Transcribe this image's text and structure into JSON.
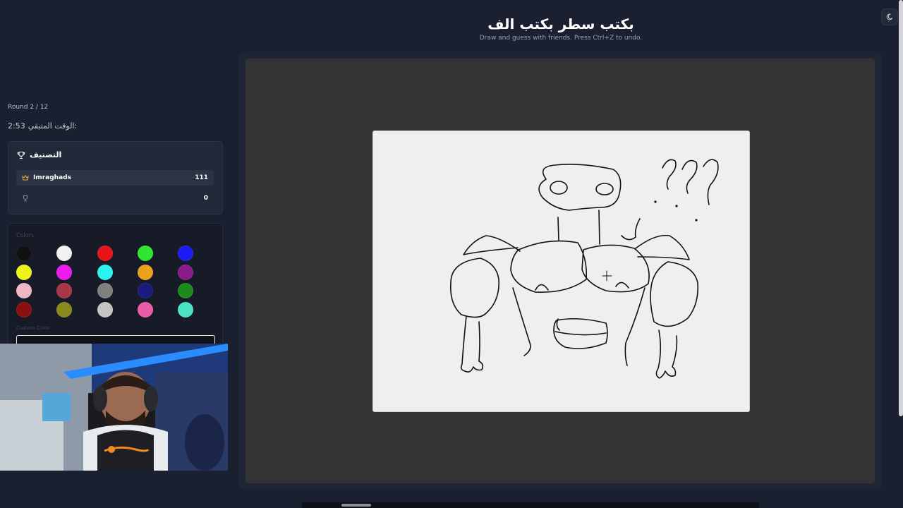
{
  "header": {
    "title": "بكتب سطر بكتب الف",
    "subtitle": "Draw and guess with friends. Press Ctrl+Z to undo."
  },
  "theme_toggle_icon": "moon-icon",
  "game": {
    "round": "Round 2 / 12",
    "time_label": "الوقت المتبقي:",
    "time_value": "2:53"
  },
  "leaderboard": {
    "title": "التصنيف",
    "title_icon": "trophy-icon",
    "players": [
      {
        "name": "Imraghads",
        "score": "111",
        "icon": "crown-icon"
      },
      {
        "name": "",
        "score": "0",
        "icon": "trophy-icon"
      }
    ]
  },
  "palette": {
    "label": "Colors",
    "custom_label": "Custom Color",
    "colors": [
      "#111111",
      "#f2f2f2",
      "#e8141c",
      "#2ee62e",
      "#1c1cf0",
      "#eef21a",
      "#ee1aee",
      "#2ef2f2",
      "#eaa21c",
      "#8a1c8a",
      "#f0b8c4",
      "#a83848",
      "#808080",
      "#1a1a80",
      "#1e8a1e",
      "#8a1010",
      "#8a8a1a",
      "#c4c4c4",
      "#ea5ca8",
      "#4ae2c0"
    ]
  },
  "colors": {
    "background": "#1b2030",
    "panel": "#212838",
    "canvas_frame": "#333333",
    "drawing_board": "#efefef"
  }
}
